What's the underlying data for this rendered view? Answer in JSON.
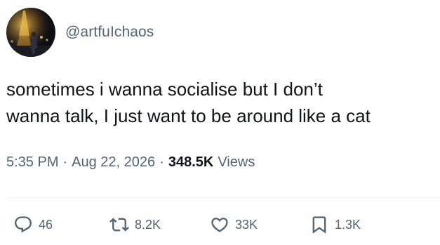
{
  "author": {
    "handle": "@artfuIchaos",
    "avatar_icon": "avatar-photo-eiffel-tower-night"
  },
  "tweet": {
    "text": "sometimes i wanna socialise but I don’t\nwanna talk, I just want to be around like a cat"
  },
  "meta": {
    "time": "5:35 PM",
    "separator_1": "·",
    "date": "Aug 22, 2026",
    "separator_2": "·",
    "views_count": "348.5K",
    "views_label": "Views"
  },
  "actions": {
    "reply": {
      "icon": "reply-icon",
      "count": "46"
    },
    "repost": {
      "icon": "repost-icon",
      "count": "8.2K"
    },
    "like": {
      "icon": "heart-icon",
      "count": "33K"
    },
    "bookmark": {
      "icon": "bookmark-icon",
      "count": "1.3K"
    }
  },
  "colors": {
    "primary_text": "#0f1419",
    "secondary_text": "#536471",
    "divider": "#eff3f4"
  }
}
